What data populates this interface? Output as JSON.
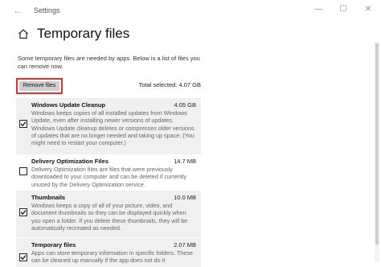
{
  "window": {
    "title": "Settings",
    "minimize_glyph": "—",
    "maximize_glyph": "☐",
    "close_glyph": "✕",
    "back_glyph": "←"
  },
  "page": {
    "title": "Temporary files",
    "intro": "Some temporary files are needed by apps. Below is a list of files you can remove now.",
    "remove_button": "Remove files",
    "total_selected": "Total selected: 4.07 GB"
  },
  "items": [
    {
      "name": "Windows Update Cleanup",
      "size": "4.05 GB",
      "checked": true,
      "description": "Windows keeps copies of all installed updates from Windows Update, even after installing newer versions of updates. Windows Update cleanup deletes or compresses older versions of updates that are no longer needed and taking up space. (You might need to restart your computer.)"
    },
    {
      "name": "Delivery Optimization Files",
      "size": "14.7 MB",
      "checked": false,
      "description": "Delivery Optimization files are files that were previously downloaded to your computer and can be deleted if currently unused by the Delivery Optimization service."
    },
    {
      "name": "Thumbnails",
      "size": "10.0 MB",
      "checked": true,
      "description": "Windows keeps a copy of all of your picture, video, and document thumbnails so they can be displayed quickly when you open a folder. If you delete these thumbnails, they will be automatically recreated as needed."
    },
    {
      "name": "Temporary files",
      "size": "2.07 MB",
      "checked": true,
      "description": "Apps can store temporary information in specific folders. These can be cleaned up manually if the app does not do it automatically."
    }
  ],
  "colors": {
    "accent_highlight": "#e0302a",
    "item_background": "#f0f0f0",
    "button_background": "#cfcfcf"
  }
}
